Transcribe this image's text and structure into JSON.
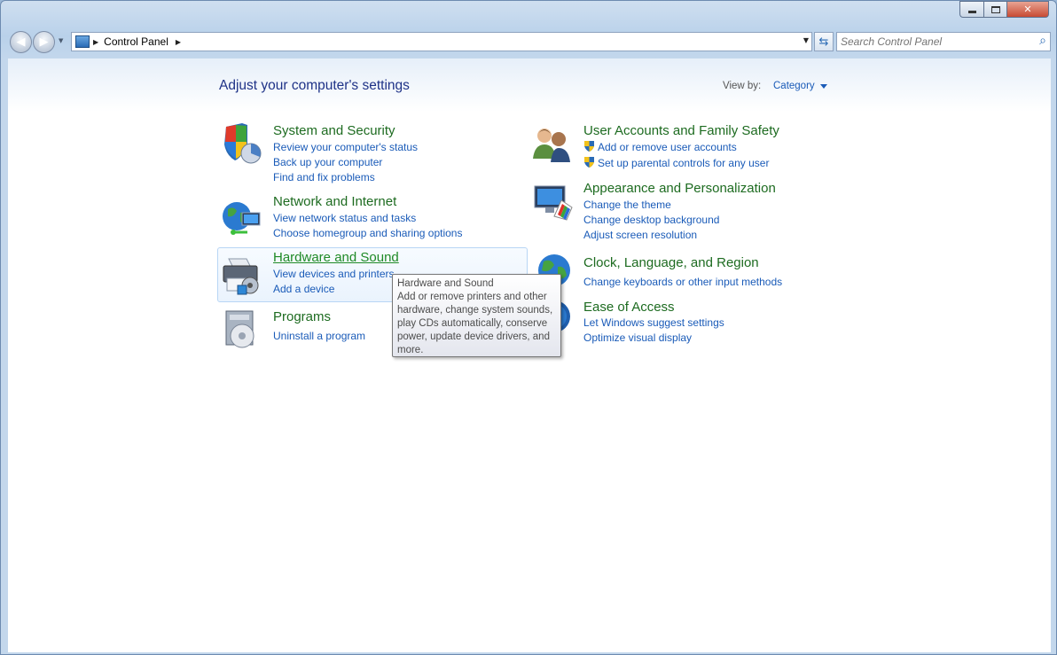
{
  "window": {
    "caption": {
      "minimize": "minimize",
      "maximize": "maximize",
      "close": "close"
    }
  },
  "nav": {
    "breadcrumb": [
      "Control Panel"
    ],
    "search_placeholder": "Search Control Panel"
  },
  "header": {
    "title": "Adjust your computer's settings",
    "view_by_label": "View by:",
    "view_by_value": "Category"
  },
  "categories": {
    "system": {
      "title": "System and Security",
      "links": [
        "Review your computer's status",
        "Back up your computer",
        "Find and fix problems"
      ]
    },
    "network": {
      "title": "Network and Internet",
      "links": [
        "View network status and tasks",
        "Choose homegroup and sharing options"
      ]
    },
    "hardware": {
      "title": "Hardware and Sound",
      "links": [
        "View devices and printers",
        "Add a device"
      ]
    },
    "programs": {
      "title": "Programs",
      "links": [
        "Uninstall a program"
      ]
    },
    "users": {
      "title": "User Accounts and Family Safety",
      "links": [
        "Add or remove user accounts",
        "Set up parental controls for any user"
      ]
    },
    "appearance": {
      "title": "Appearance and Personalization",
      "links": [
        "Change the theme",
        "Change desktop background",
        "Adjust screen resolution"
      ]
    },
    "clock": {
      "title": "Clock, Language, and Region",
      "links": [
        "Change keyboards or other input methods"
      ]
    },
    "ease": {
      "title": "Ease of Access",
      "links": [
        "Let Windows suggest settings",
        "Optimize visual display"
      ]
    }
  },
  "tooltip": {
    "title": "Hardware and Sound",
    "lines": [
      "Add or remove printers and other",
      "hardware, change system sounds,",
      "play CDs automatically, conserve",
      "power, update device drivers, and",
      "more."
    ]
  },
  "colors": {
    "link": "#1a5bb8",
    "category_title": "#1d6b20",
    "heading": "#1e3287"
  }
}
